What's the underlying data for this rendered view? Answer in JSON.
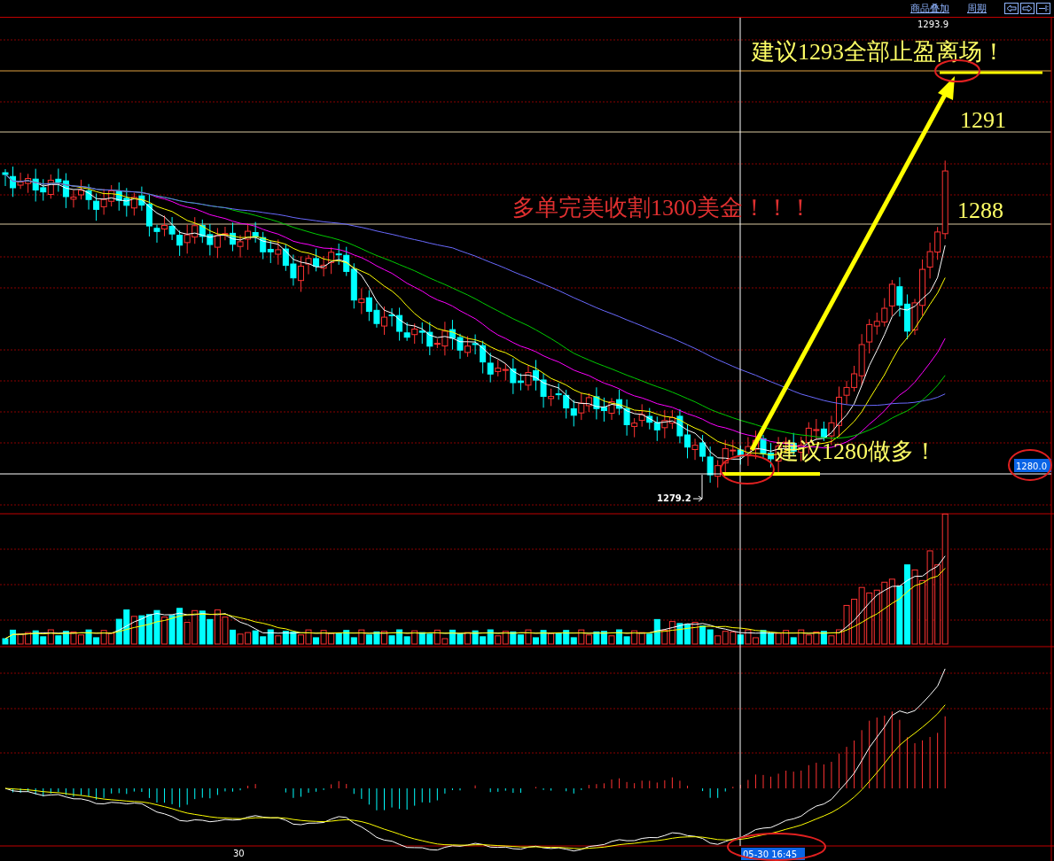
{
  "toolbar": {
    "links": [
      "商品叠加",
      "周期"
    ]
  },
  "price_labels": {
    "high": "1293.9",
    "low": "1279.2",
    "crosshair": "1280.0"
  },
  "annotations": {
    "exit": "建议1293全部止盈离场！",
    "level_upper": "1291",
    "level_lower": "1288",
    "headline": "多单完美收割1300美金！！！",
    "entry": "建议1280做多！"
  },
  "time_axis": {
    "tick": "30",
    "crosshair_time": "05-30 16:45"
  }
}
